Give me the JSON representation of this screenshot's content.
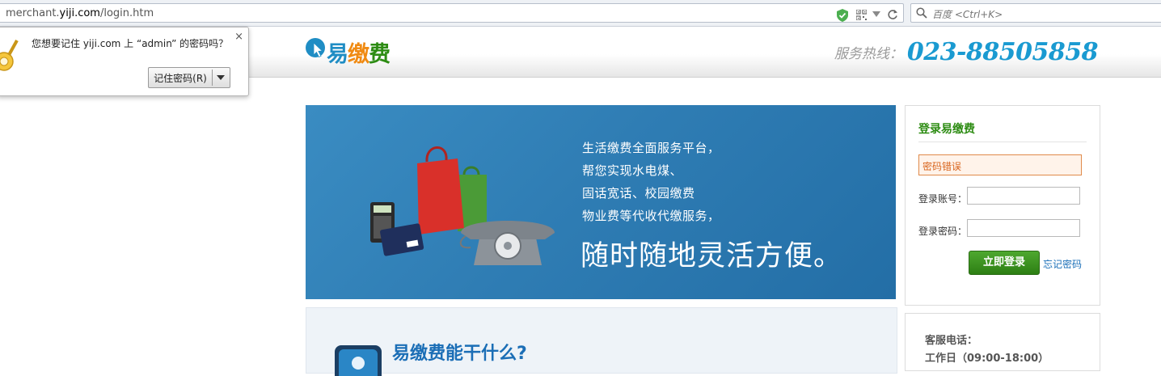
{
  "browser": {
    "url_prefix": "merchant.",
    "url_domain": "yiji.com",
    "url_path": "/login.htm",
    "search_placeholder": "百度 <Ctrl+K>"
  },
  "password_prompt": {
    "message": "您想要记住 yiji.com 上 “admin” 的密码吗？",
    "remember_label": "记住密码(R)",
    "close_label": "×"
  },
  "header": {
    "logo_text_1": "易",
    "logo_text_2": "缴",
    "logo_text_3": "费",
    "hotline_label": "服务热线：",
    "hotline_number": "023-88505858"
  },
  "banner": {
    "lines": [
      "生活缴费全面服务平台，",
      "帮您实现水电煤、",
      "固话宽话、校园缴费",
      "物业费等代收代缴服务，"
    ],
    "headline": "随时随地灵活方便。"
  },
  "login": {
    "title": "登录易缴费",
    "error": "密码错误",
    "account_label": "登录账号：",
    "password_label": "登录密码：",
    "submit_label": "立即登录",
    "forgot_label": "忘记密码"
  },
  "features": {
    "title": "易缴费能干什么?"
  },
  "service": {
    "phone_label": "客服电话：",
    "hours": "工作日（09:00-18:00）"
  },
  "colors": {
    "accent_blue": "#1a9ad1",
    "brand_green": "#2d8c13",
    "logo_orange": "#f08a12",
    "error_orange": "#d8641c"
  }
}
